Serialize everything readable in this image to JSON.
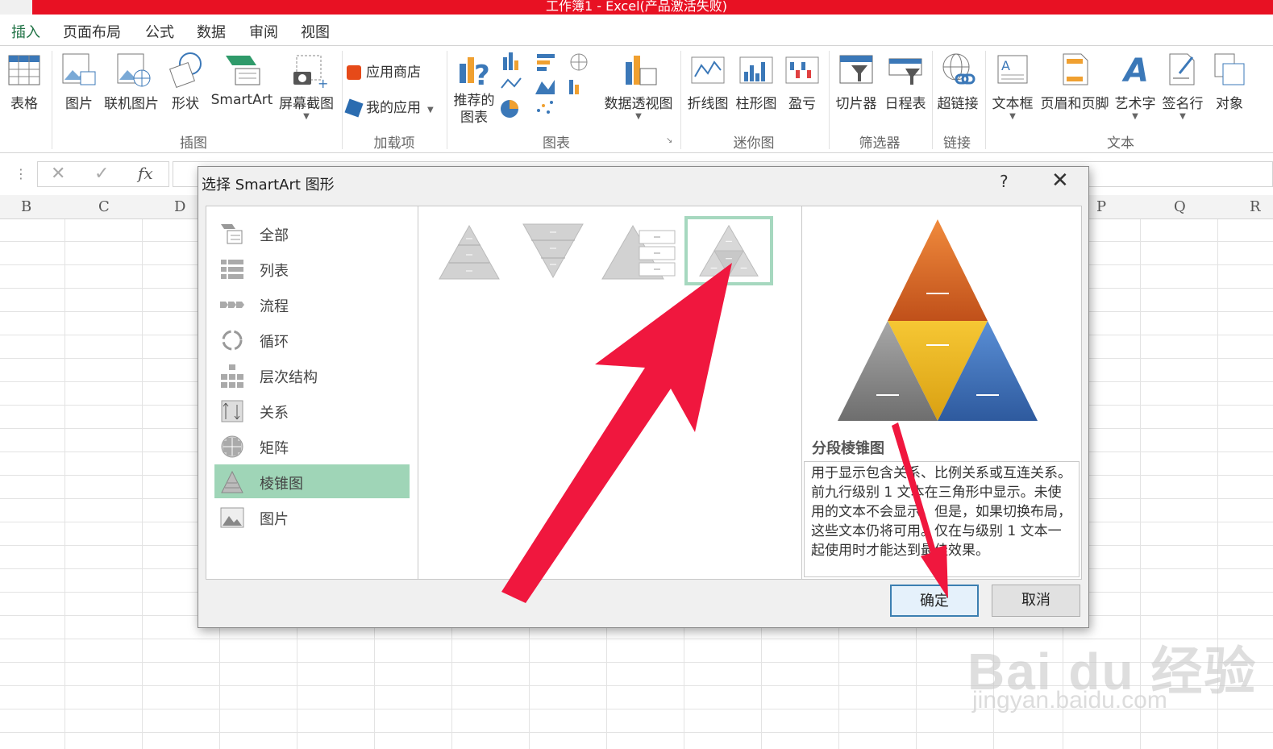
{
  "window": {
    "title": "工作簿1 - Excel(产品激活失败)"
  },
  "ribbon_tabs": [
    "插入",
    "页面布局",
    "公式",
    "数据",
    "审阅",
    "视图"
  ],
  "ribbon": {
    "table": "表格",
    "picture": "图片",
    "online_picture": "联机图片",
    "shapes": "形状",
    "smartart": "SmartArt",
    "screenshot": "屏幕截图",
    "app_store": "应用商店",
    "my_apps": "我的应用",
    "recommended_charts_1": "推荐的",
    "recommended_charts_2": "图表",
    "pivot_chart": "数据透视图",
    "line_spark": "折线图",
    "column_spark": "柱形图",
    "winloss_spark": "盈亏",
    "slicer": "切片器",
    "timeline": "日程表",
    "hyperlink": "超链接",
    "textbox": "文本框",
    "header_footer": "页眉和页脚",
    "wordart": "艺术字",
    "signature": "签名行",
    "object": "对象",
    "groups": {
      "illustrations": "插图",
      "addins": "加载项",
      "charts": "图表",
      "sparklines": "迷你图",
      "filters": "筛选器",
      "links": "链接",
      "text": "文本"
    }
  },
  "formula_bar": {
    "fx": "fx",
    "cancel": "✕",
    "enter": "✓"
  },
  "columns": [
    "B",
    "C",
    "D",
    "P",
    "Q",
    "R"
  ],
  "dialog": {
    "title": "选择 SmartArt 图形",
    "help": "?",
    "close": "✕",
    "categories": [
      "全部",
      "列表",
      "流程",
      "循环",
      "层次结构",
      "关系",
      "矩阵",
      "棱锥图",
      "图片"
    ],
    "selected_category": "棱锥图",
    "gallery_items": [
      "基本棱锥图",
      "倒棱锥图",
      "棱锥型列表",
      "分段棱锥图"
    ],
    "preview": {
      "name": "分段棱锥图",
      "description": "用于显示包含关系、比例关系或互连关系。前九行级别 1 文本在三角形中显示。未使用的文本不会显示，但是，如果切换布局，这些文本仍将可用。仅在与级别 1 文本一起使用时才能达到最佳效果。"
    },
    "ok": "确定",
    "cancel": "取消"
  },
  "watermark": {
    "logo": "Bai du 经验",
    "url": "jingyan.baidu.com"
  },
  "colors": {
    "title_bar": "#e81123",
    "accent": "#217346",
    "selection": "#9fd5b7",
    "arrow": "#f0173e"
  }
}
